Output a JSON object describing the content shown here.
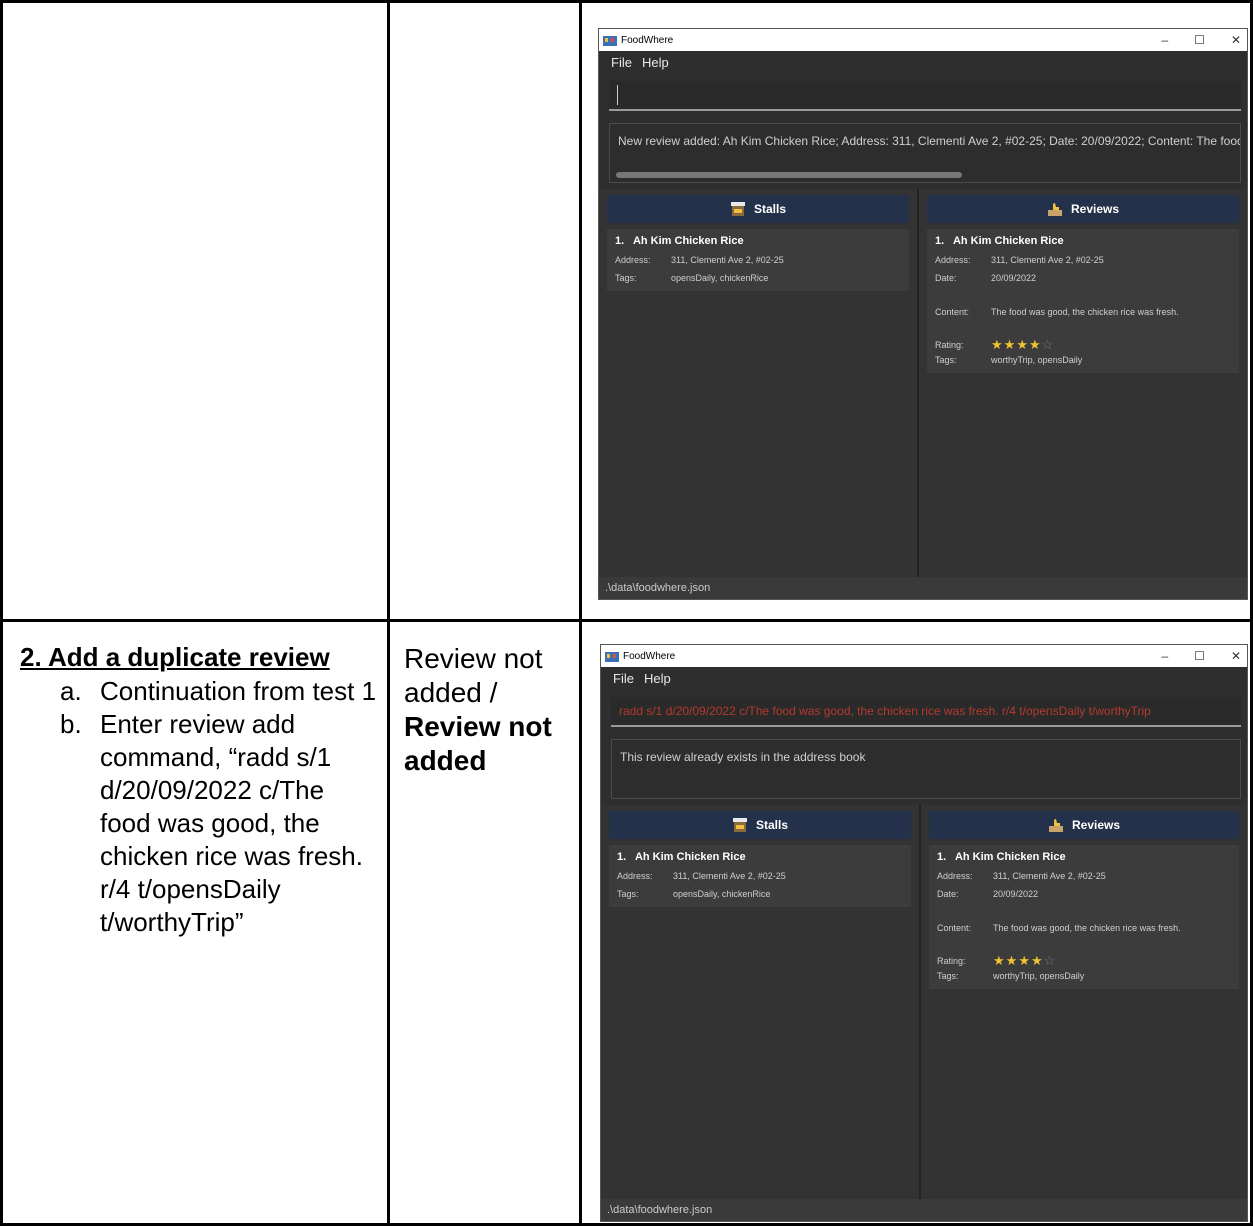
{
  "row2": {
    "title": "2. Add a duplicate review",
    "steps": [
      {
        "label": "a.",
        "text": "Continuation from test 1"
      },
      {
        "label": "b.",
        "text": "Enter review add command, “radd s/1 d/20/09/2022 c/The food was good, the chicken rice was fresh. r/4 t/opensDaily t/worthyTrip”"
      }
    ],
    "expected_plain": "Review not added /",
    "expected_bold": "Review not added"
  },
  "windows": [
    {
      "title": "FoodWhere",
      "menu": [
        "File",
        "Help"
      ],
      "command_text": "",
      "result_text": "New review added: Ah Kim Chicken Rice; Address: 311, Clementi Ave 2, #02-25; Date: 20/09/2022; Content: The food was good, the chicken rice was fresh.",
      "stalls_header": "Stalls",
      "reviews_header": "Reviews",
      "stall": {
        "index": "1.",
        "name": "Ah Kim Chicken Rice",
        "address_label": "Address:",
        "address": "311, Clementi Ave 2, #02-25",
        "tags_label": "Tags:",
        "tags": "opensDaily, chickenRice"
      },
      "review": {
        "index": "1.",
        "name": "Ah Kim Chicken Rice",
        "address_label": "Address:",
        "address": "311, Clementi Ave 2, #02-25",
        "date_label": "Date:",
        "date": "20/09/2022",
        "content_label": "Content:",
        "content": "The food was good, the chicken rice was fresh.",
        "rating_label": "Rating:",
        "rating": 4,
        "rating_max": 5,
        "tags_label": "Tags:",
        "tags": "worthyTrip, opensDaily"
      },
      "status": ".\\data\\foodwhere.json"
    },
    {
      "title": "FoodWhere",
      "menu": [
        "File",
        "Help"
      ],
      "command_text": "radd s/1 d/20/09/2022 c/The food was good, the chicken rice was fresh. r/4 t/opensDaily t/worthyTrip",
      "result_text": "This review already exists in the address book",
      "stalls_header": "Stalls",
      "reviews_header": "Reviews",
      "stall": {
        "index": "1.",
        "name": "Ah Kim Chicken Rice",
        "address_label": "Address:",
        "address": "311, Clementi Ave 2, #02-25",
        "tags_label": "Tags:",
        "tags": "opensDaily, chickenRice"
      },
      "review": {
        "index": "1.",
        "name": "Ah Kim Chicken Rice",
        "address_label": "Address:",
        "address": "311, Clementi Ave 2, #02-25",
        "date_label": "Date:",
        "date": "20/09/2022",
        "content_label": "Content:",
        "content": "The food was good, the chicken rice was fresh.",
        "rating_label": "Rating:",
        "rating": 4,
        "rating_max": 5,
        "tags_label": "Tags:",
        "tags": "worthyTrip, opensDaily"
      },
      "status": ".\\data\\foodwhere.json"
    }
  ],
  "window_controls": {
    "minimize": "–",
    "maximize": "☐",
    "close": "✕"
  },
  "colors": {
    "panel_header": "#23324a",
    "error_text": "#b33a2e",
    "star": "#f1c232",
    "app_bg": "#2e2e2e"
  }
}
